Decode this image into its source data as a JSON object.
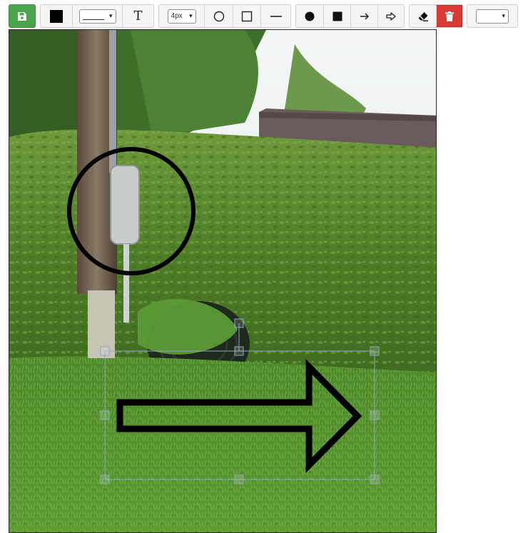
{
  "toolbar": {
    "save_label": "",
    "stroke_color": "#000000",
    "line_style_value": "",
    "text_tool_glyph": "T",
    "stroke_width_value": "4px",
    "font_value": ""
  },
  "colors": {
    "save_bg": "#4aa54a",
    "delete_bg": "#d93a36",
    "annotation_stroke": "#000000",
    "selection_box": "#8ea6c8"
  },
  "icons": [
    "save-icon",
    "color-swatch",
    "text-icon",
    "circle-outline-icon",
    "square-outline-icon",
    "line-icon",
    "filled-circle-icon",
    "filled-square-icon",
    "arrow-icon",
    "outline-arrow-icon",
    "eraser-icon",
    "trash-icon",
    "chevron-down-icon"
  ],
  "canvas": {
    "annotations": [
      "circle",
      "outline-arrow"
    ],
    "selected": "outline-arrow"
  }
}
